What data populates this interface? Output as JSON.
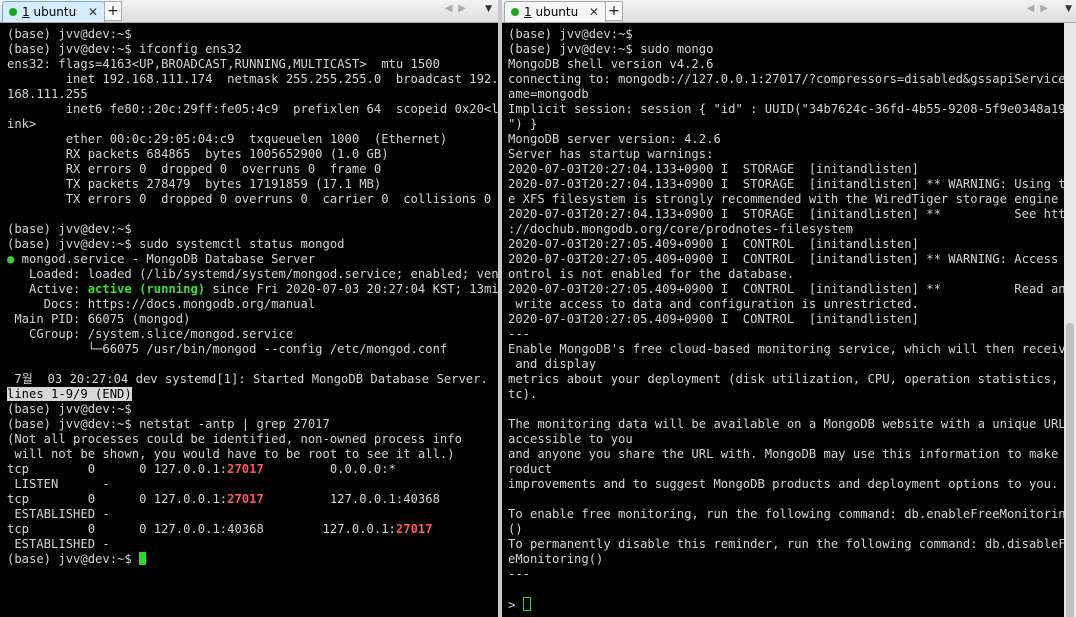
{
  "left": {
    "tab_label_num": "1",
    "tab_label": "ubuntu",
    "tab_close": "✕",
    "new_tab": "+",
    "lines": [
      "(base) jvv@dev:~$",
      "(base) jvv@dev:~$ ifconfig ens32",
      "ens32: flags=4163<UP,BROADCAST,RUNNING,MULTICAST>  mtu 1500",
      "        inet 192.168.111.174  netmask 255.255.255.0  broadcast 192.",
      "168.111.255",
      "        inet6 fe80::20c:29ff:fe05:4c9  prefixlen 64  scopeid 0x20<l",
      "ink>",
      "        ether 00:0c:29:05:04:c9  txqueuelen 1000  (Ethernet)",
      "        RX packets 684865  bytes 1005652900 (1.0 GB)",
      "        RX errors 0  dropped 0  overruns 0  frame 0",
      "        TX packets 278479  bytes 17191859 (17.1 MB)",
      "        TX errors 0  dropped 0 overruns 0  carrier 0  collisions 0",
      "",
      "(base) jvv@dev:~$",
      "(base) jvv@dev:~$ sudo systemctl status mongod",
      "mongod.service - MongoDB Database Server",
      "   Loaded: loaded (/lib/systemd/system/mongod.service; enabled; ven",
      "   Active: ",
      "     Docs: https://docs.mongodb.org/manual",
      " Main PID: 66075 (mongod)",
      "   CGroup: /system.slice/mongod.service",
      "           └─66075 /usr/bin/mongod --config /etc/mongod.conf",
      "",
      " 7월  03 20:27:04 dev systemd[1]: Started MongoDB Database Server.",
      "lines 1-9/9 (END)",
      "(base) jvv@dev:~$",
      "(base) jvv@dev:~$ netstat -antp | grep 27017",
      "(Not all processes could be identified, non-owned process info",
      " will not be shown, you would have to be root to see it all.)",
      "tcp        0      0 127.0.0.1:",
      " LISTEN      -",
      "tcp        0      0 127.0.0.1:",
      " ESTABLISHED -",
      "tcp        0      0 127.0.0.1:40368        127.0.0.1:",
      " ESTABLISHED -",
      "(base) jvv@dev:~$ "
    ],
    "service_bullet": "●",
    "active_state": "active (running)",
    "active_rest": " since Fri 2020-07-03 20:27:04 KST; 13mi",
    "port": "27017",
    "listen_rest": "         0.0.0.0:*",
    "est1_rest": "         127.0.0.1:40368"
  },
  "right": {
    "tab_label_num": "1",
    "tab_label": "ubuntu",
    "tab_close": "✕",
    "new_tab": "+",
    "lines": [
      "(base) jvv@dev:~$",
      "(base) jvv@dev:~$ sudo mongo",
      "MongoDB shell version v4.2.6",
      "connecting to: mongodb://127.0.0.1:27017/?compressors=disabled&gssapiServiceN",
      "ame=mongodb",
      "Implicit session: session { \"id\" : UUID(\"34b7624c-36fd-4b55-9208-5f9e0348a193",
      "\") }",
      "MongoDB server version: 4.2.6",
      "Server has startup warnings:",
      "2020-07-03T20:27:04.133+0900 I  STORAGE  [initandlisten]",
      "2020-07-03T20:27:04.133+0900 I  STORAGE  [initandlisten] ** WARNING: Using th",
      "e XFS filesystem is strongly recommended with the WiredTiger storage engine",
      "2020-07-03T20:27:04.133+0900 I  STORAGE  [initandlisten] **          See http",
      "://dochub.mongodb.org/core/prodnotes-filesystem",
      "2020-07-03T20:27:05.409+0900 I  CONTROL  [initandlisten]",
      "2020-07-03T20:27:05.409+0900 I  CONTROL  [initandlisten] ** WARNING: Access c",
      "ontrol is not enabled for the database.",
      "2020-07-03T20:27:05.409+0900 I  CONTROL  [initandlisten] **          Read and",
      " write access to data and configuration is unrestricted.",
      "2020-07-03T20:27:05.409+0900 I  CONTROL  [initandlisten]",
      "---",
      "Enable MongoDB's free cloud-based monitoring service, which will then receive",
      " and display",
      "metrics about your deployment (disk utilization, CPU, operation statistics, e",
      "tc).",
      "",
      "The monitoring data will be available on a MongoDB website with a unique URL",
      "accessible to you",
      "and anyone you share the URL with. MongoDB may use this information to make p",
      "roduct",
      "improvements and to suggest MongoDB products and deployment options to you.",
      "",
      "To enable free monitoring, run the following command: db.enableFreeMonitoring",
      "()",
      "To permanently disable this reminder, run the following command: db.disableFre",
      "eMonitoring()",
      "---",
      "",
      "> "
    ]
  }
}
